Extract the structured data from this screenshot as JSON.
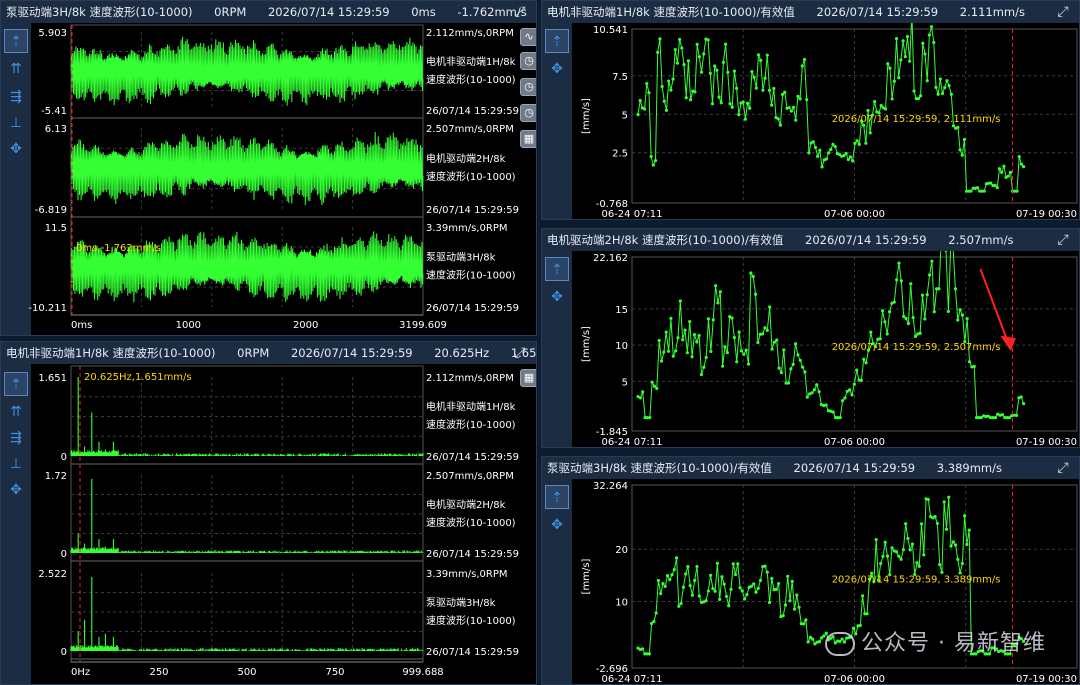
{
  "colors": {
    "trace": "#33ff33",
    "cursor": "#ff2020",
    "label": "#ffffff",
    "annot": "#ffd700",
    "grid": "#3a3a3a"
  },
  "p1": {
    "title": [
      "泵驱动端3H/8k 速度波形(10-1000)",
      "0RPM",
      "2026/07/14 15:29:59",
      "0ms",
      "-1.762mm/s"
    ],
    "cursor_label": "0ms,-1.762mm/s",
    "xticks": [
      "0ms",
      "1000",
      "2000",
      "3199.609"
    ],
    "channels": [
      {
        "ytop": "5.903",
        "ybot": "-5.41",
        "info": "2.112mm/s,0RPM",
        "name": "电机非驱动端1H/8k 速度波形(10-1000)",
        "time": "26/07/14 15:29:59"
      },
      {
        "ytop": "6.13",
        "ybot": "-6.819",
        "info": "2.507mm/s,0RPM",
        "name": "电机驱动端2H/8k 速度波形(10-1000)",
        "time": "26/07/14 15:29:59"
      },
      {
        "ytop": "11.5",
        "ybot": "-10.211",
        "info": "3.39mm/s,0RPM",
        "name": "泵驱动端3H/8k 速度波形(10-1000)",
        "time": "26/07/14 15:29:59"
      }
    ]
  },
  "p2": {
    "title": [
      "电机非驱动端1H/8k 速度波形(10-1000)",
      "0RPM",
      "2026/07/14 15:29:59",
      "20.625Hz",
      "1.651mm/s"
    ],
    "cursor_label": "20.625Hz,1.651mm/s",
    "xticks": [
      "0Hz",
      "250",
      "500",
      "750",
      "999.688"
    ],
    "channels": [
      {
        "ytop": "1.651",
        "ybot": "0",
        "info": "2.112mm/s,0RPM",
        "name": "电机非驱动端1H/8k 速度波形(10-1000)",
        "time": "26/07/14 15:29:59"
      },
      {
        "ytop": "1.72",
        "ybot": "0",
        "info": "2.507mm/s,0RPM",
        "name": "电机驱动端2H/8k 速度波形(10-1000)",
        "time": "26/07/14 15:29:59"
      },
      {
        "ytop": "2.522",
        "ybot": "0",
        "info": "3.39mm/s,0RPM",
        "name": "泵驱动端3H/8k 速度波形(10-1000)",
        "time": "26/07/14 15:29:59"
      }
    ]
  },
  "trends": [
    {
      "title": [
        "电机非驱动端1H/8k 速度波形(10-1000)/有效值",
        "2026/07/14 15:29:59",
        "2.111mm/s"
      ],
      "yunit": "[mm/s]",
      "yticks": [
        "10.541",
        "7.5",
        "5",
        "2.5",
        "-0.768"
      ],
      "xticks": [
        "06-24 07:11",
        "07-06 00:00",
        "07-19 00:30"
      ],
      "annot": "2026/07/14 15:29:59, 2.111mm/s"
    },
    {
      "title": [
        "电机驱动端2H/8k 速度波形(10-1000)/有效值",
        "2026/07/14 15:29:59",
        "2.507mm/s"
      ],
      "yunit": "[mm/s]",
      "yticks": [
        "22.162",
        "15",
        "10",
        "5",
        "-1.845"
      ],
      "xticks": [
        "06-24 07:11",
        "07-06 00:00",
        "07-19 00:30"
      ],
      "annot": "2026/07/14 15:29:59, 2.507mm/s"
    },
    {
      "title": [
        "泵驱动端3H/8k 速度波形(10-1000)/有效值",
        "2026/07/14 15:29:59",
        "3.389mm/s"
      ],
      "yunit": "[mm/s]",
      "yticks": [
        "32.264",
        "20",
        "10",
        "-2.696"
      ],
      "xticks": [
        "06-24 07:11",
        "07-06 00:00",
        "07-19 00:30"
      ],
      "annot": "2026/07/14 15:29:59, 3.389mm/s"
    }
  ],
  "watermark": "公众号 · 易新智维",
  "icons": {
    "toolbar": [
      "cursor-icon",
      "harmonic-cursor-icon",
      "sideband-cursor-icon",
      "baseline-icon",
      "pan-icon"
    ],
    "rtools": [
      "waveform-icon",
      "clock-icon",
      "clock-icon",
      "clock-icon",
      "grid-icon"
    ]
  }
}
